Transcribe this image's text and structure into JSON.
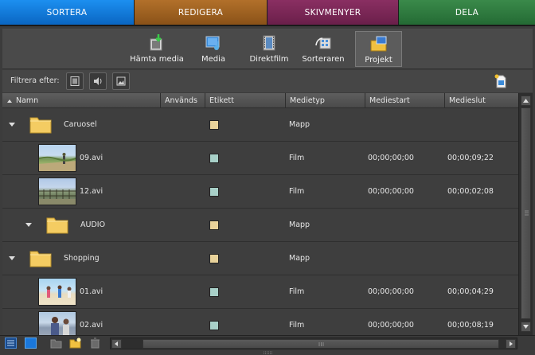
{
  "tabs": [
    {
      "label": "SORTERA",
      "color": "#0a78dc"
    },
    {
      "label": "REDIGERA",
      "color": "#a0622a"
    },
    {
      "label": "SKIVMENYER",
      "color": "#7a2a5a"
    },
    {
      "label": "DELA",
      "color": "#2f7a3f"
    }
  ],
  "toolbar": {
    "items": [
      {
        "label": "Hämta media",
        "icon": "get-media-icon"
      },
      {
        "label": "Media",
        "icon": "media-icon"
      },
      {
        "label": "Direktfilm",
        "icon": "instant-movie-icon"
      },
      {
        "label": "Sorteraren",
        "icon": "organizer-icon"
      },
      {
        "label": "Projekt",
        "icon": "project-icon",
        "active": true
      }
    ]
  },
  "filter": {
    "label": "Filtrera efter:",
    "buttons": [
      "video-filter-icon",
      "audio-filter-icon",
      "image-filter-icon"
    ]
  },
  "table": {
    "columns": [
      "Namn",
      "Används",
      "Etikett",
      "Medietyp",
      "Mediestart",
      "Medieslut"
    ],
    "rows": [
      {
        "name": "Caruosel",
        "kind": "folder",
        "level": 0,
        "used": "",
        "label_color": "#e8d29a",
        "type": "Mapp",
        "start": "",
        "end": ""
      },
      {
        "name": "09.avi",
        "kind": "video",
        "level": 1,
        "used": "",
        "label_color": "#a8d0c8",
        "type": "Film",
        "start": "00;00;00;00",
        "end": "00;00;09;22"
      },
      {
        "name": "12.avi",
        "kind": "video",
        "level": 1,
        "used": "",
        "label_color": "#a8d0c8",
        "type": "Film",
        "start": "00;00;00;00",
        "end": "00;00;02;08"
      },
      {
        "name": "AUDIO",
        "kind": "folder",
        "level": 1,
        "used": "",
        "label_color": "#e8d29a",
        "type": "Mapp",
        "start": "",
        "end": ""
      },
      {
        "name": "Shopping",
        "kind": "folder",
        "level": 0,
        "used": "",
        "label_color": "#e8d29a",
        "type": "Mapp",
        "start": "",
        "end": ""
      },
      {
        "name": "01.avi",
        "kind": "video",
        "level": 1,
        "used": "",
        "label_color": "#a8d0c8",
        "type": "Film",
        "start": "00;00;00;00",
        "end": "00;00;04;29"
      },
      {
        "name": "02.avi",
        "kind": "video",
        "level": 1,
        "used": "",
        "label_color": "#a8d0c8",
        "type": "Film",
        "start": "00;00;00;00",
        "end": "00;00;08;19"
      }
    ]
  },
  "colors": {
    "folder": "#f0c860",
    "accent": "#0a78dc"
  }
}
